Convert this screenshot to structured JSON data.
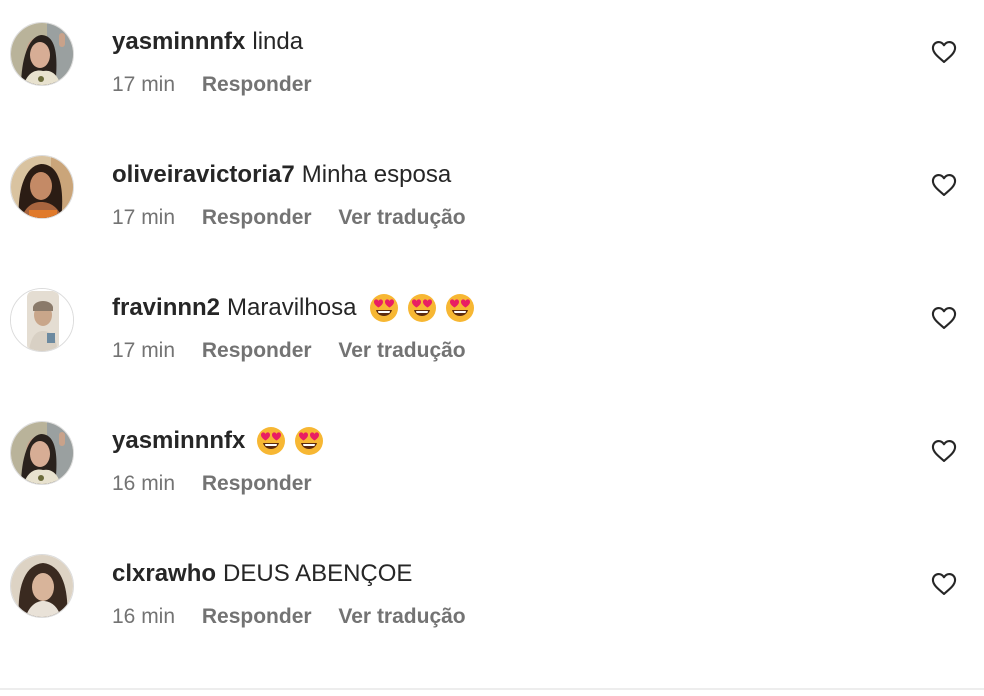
{
  "comments": [
    {
      "username": "yasminnnfx",
      "text": "linda",
      "emojis": [],
      "time": "17 min",
      "reply_label": "Responder",
      "translate_label": ""
    },
    {
      "username": "oliveiravictoria7",
      "text": "Minha esposa",
      "emojis": [],
      "time": "17 min",
      "reply_label": "Responder",
      "translate_label": "Ver tradução"
    },
    {
      "username": "fravinnn2",
      "text": "Maravilhosa",
      "emojis": [
        "heart-eyes-emoji",
        "heart-eyes-emoji",
        "heart-eyes-emoji"
      ],
      "time": "17 min",
      "reply_label": "Responder",
      "translate_label": "Ver tradução"
    },
    {
      "username": "yasminnnfx",
      "text": "",
      "emojis": [
        "heart-eyes-emoji",
        "heart-eyes-emoji"
      ],
      "time": "16 min",
      "reply_label": "Responder",
      "translate_label": ""
    },
    {
      "username": "clxrawho",
      "text": "DEUS ABENÇOE",
      "emojis": [],
      "time": "16 min",
      "reply_label": "Responder",
      "translate_label": "Ver tradução"
    }
  ],
  "icons": {
    "like": "heart-outline-icon",
    "emoji": "heart-eyes-emoji"
  },
  "colors": {
    "username": "#262626",
    "meta": "#737373",
    "emoji_face": "#f7b733",
    "emoji_hearts": "#e91e63"
  }
}
